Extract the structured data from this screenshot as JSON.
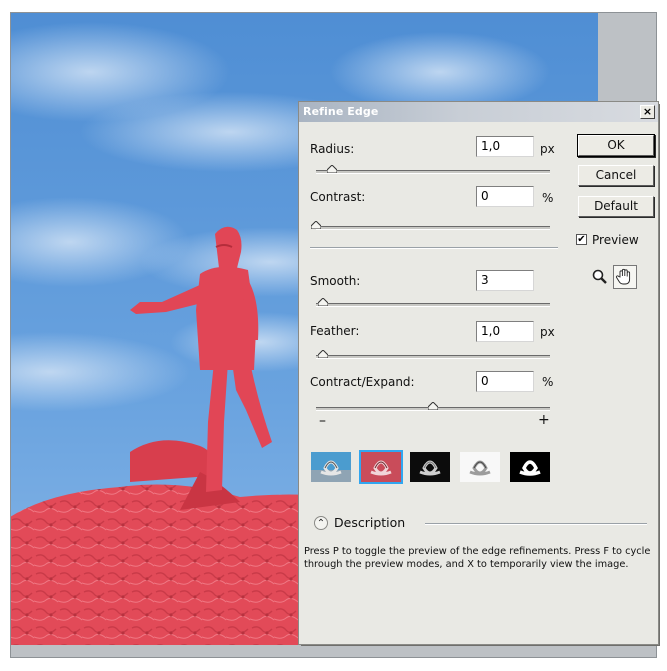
{
  "dialog": {
    "title": "Refine Edge",
    "close_glyph": "×",
    "radius": {
      "label": "Radius:",
      "value": "1,0",
      "unit": "px",
      "slider_level": 0.07
    },
    "contrast": {
      "label": "Contrast:",
      "value": "0",
      "unit": "%",
      "slider_level": 0.0
    },
    "smooth": {
      "label": "Smooth:",
      "value": "3",
      "slider_level": 0.03
    },
    "feather": {
      "label": "Feather:",
      "value": "1,0",
      "unit": "px",
      "slider_level": 0.03
    },
    "contract_expand": {
      "label": "Contract/Expand:",
      "value": "0",
      "unit": "%",
      "slider_level": 0.5,
      "minus": "–",
      "plus": "+"
    },
    "buttons": {
      "ok": "OK",
      "cancel": "Cancel",
      "default": "Default"
    },
    "preview": {
      "label": "Preview",
      "checked": true,
      "check_glyph": "✔"
    },
    "tools": [
      "zoom-icon",
      "hand-icon"
    ],
    "preview_modes": [
      "standard",
      "quick-mask",
      "on-black",
      "on-white",
      "mask"
    ],
    "selected_mode": "quick-mask",
    "description": {
      "toggle_glyph": "⌃",
      "label": "Description",
      "text": "Press P to toggle the preview of the edge refinements. Press F to cycle through the preview modes, and X to temporarily view the image."
    }
  },
  "colors": {
    "sky": "#5c95d6",
    "mask_red": "#e24a58",
    "panel": "#e9e9e4",
    "title_bar": "#a9b4c2",
    "selected_outline": "#31a6f0"
  }
}
